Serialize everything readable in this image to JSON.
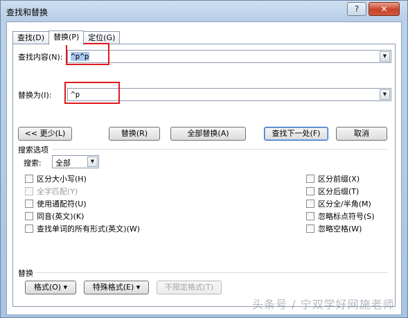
{
  "window": {
    "title": "查找和替换",
    "help_label": "?",
    "close_label": "✕"
  },
  "tabs": [
    {
      "label": "查找(D)"
    },
    {
      "label": "替换(P)",
      "active": true
    },
    {
      "label": "定位(G)"
    }
  ],
  "find": {
    "label": "查找内容(N):",
    "value": "^p^p"
  },
  "replace": {
    "label": "替换为(I):",
    "value": "^p"
  },
  "buttons": {
    "less": "<< 更少(L)",
    "replace": "替换(R)",
    "replace_all": "全部替换(A)",
    "find_next": "查找下一处(F)",
    "cancel": "取消"
  },
  "search_options": {
    "section_label": "搜索选项",
    "search_label": "搜索:",
    "search_value": "全部"
  },
  "options_left": [
    {
      "label": "区分大小写(H)",
      "checked": false,
      "disabled": false
    },
    {
      "label": "全字匹配(Y)",
      "checked": false,
      "disabled": true
    },
    {
      "label": "使用通配符(U)",
      "checked": false,
      "disabled": false
    },
    {
      "label": "同音(英文)(K)",
      "checked": false,
      "disabled": false
    },
    {
      "label": "查找单词的所有形式(英文)(W)",
      "checked": false,
      "disabled": false
    }
  ],
  "options_right": [
    {
      "label": "区分前缀(X)",
      "checked": false
    },
    {
      "label": "区分后缀(T)",
      "checked": false
    },
    {
      "label": "区分全/半角(M)",
      "checked": false
    },
    {
      "label": "忽略标点符号(S)",
      "checked": false
    },
    {
      "label": "忽略空格(W)",
      "checked": false
    }
  ],
  "replace_section": {
    "label": "替换",
    "format": "格式(O) ▾",
    "special": "特殊格式(E) ▾",
    "no_format": "不限定格式(T)"
  },
  "watermark": "头条号 / 宁双学好网施老师",
  "colors": {
    "annotation_red": "#e0191c",
    "selection": "#a8c8f0"
  }
}
